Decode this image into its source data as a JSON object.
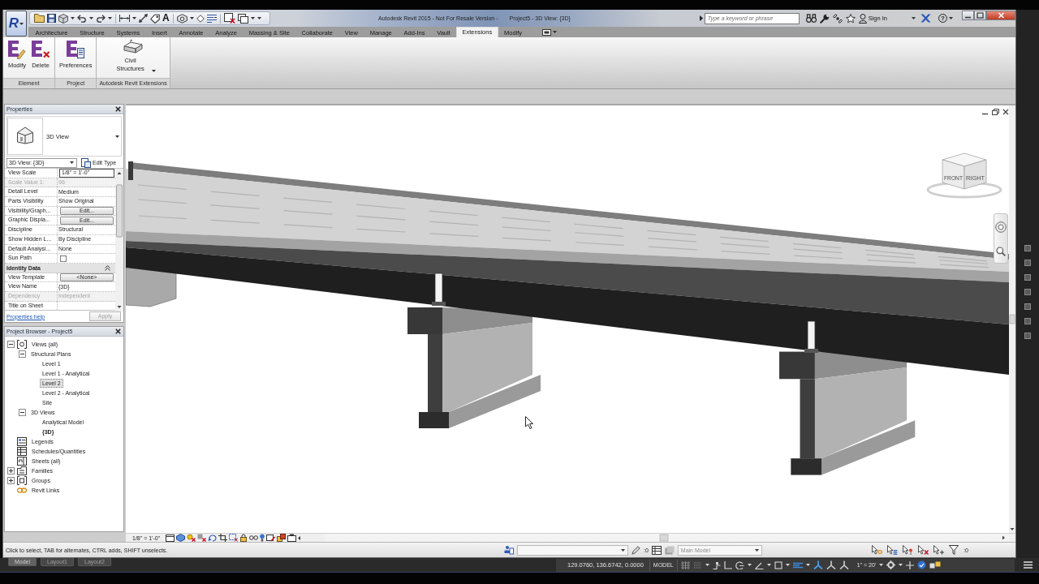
{
  "title_bar": {
    "app_button": "R",
    "text_tool": "A",
    "title": "Autodesk Revit 2015 - Not For Resale Version -",
    "document": "Project5 - 3D View: {3D}",
    "search": {
      "placeholder": "Type a keyword or phrase"
    },
    "sign_in": "Sign In",
    "help": "?"
  },
  "ribbon": {
    "tabs": [
      {
        "label": "Architecture",
        "selected": false
      },
      {
        "label": "Structure",
        "selected": false
      },
      {
        "label": "Systems",
        "selected": false
      },
      {
        "label": "Insert",
        "selected": false
      },
      {
        "label": "Annotate",
        "selected": false
      },
      {
        "label": "Analyze",
        "selected": false
      },
      {
        "label": "Massing & Site",
        "selected": false
      },
      {
        "label": "Collaborate",
        "selected": false
      },
      {
        "label": "View",
        "selected": false
      },
      {
        "label": "Manage",
        "selected": false
      },
      {
        "label": "Add-Ins",
        "selected": false
      },
      {
        "label": "Vault",
        "selected": false
      },
      {
        "label": "Extensions",
        "selected": true
      },
      {
        "label": "Modify",
        "selected": false
      }
    ],
    "panels": [
      {
        "label": "Element",
        "buttons": [
          {
            "label": "Modify",
            "kind": "modify",
            "dropdown": false
          },
          {
            "label": "Delete",
            "kind": "delete",
            "dropdown": false
          }
        ]
      },
      {
        "label": "Project",
        "buttons": [
          {
            "label": "Preferences",
            "kind": "preferences",
            "dropdown": false
          }
        ]
      },
      {
        "label": "Autodesk Revit Extensions",
        "buttons": [
          {
            "label": "Civil Structures",
            "kind": "civil",
            "dropdown": true
          }
        ]
      }
    ]
  },
  "properties": {
    "title": "Properties",
    "type_name": "3D View",
    "instance_selector": "3D View: {3D}",
    "edit_type": "Edit Type",
    "rows": [
      {
        "kind": "input",
        "name": "View Scale",
        "value": "1/8\" = 1'-0\"",
        "disabled": false
      },
      {
        "kind": "text",
        "name": "Scale Value    1:",
        "value": "96",
        "disabled": true
      },
      {
        "kind": "text",
        "name": "Detail Level",
        "value": "Medium",
        "disabled": false
      },
      {
        "kind": "text",
        "name": "Parts Visibility",
        "value": "Show Original",
        "disabled": false
      },
      {
        "kind": "button",
        "name": "Visibility/Graph...",
        "value": "Edit...",
        "disabled": false
      },
      {
        "kind": "button",
        "name": "Graphic Displa...",
        "value": "Edit...",
        "disabled": false
      },
      {
        "kind": "text",
        "name": "Discipline",
        "value": "Structural",
        "disabled": false
      },
      {
        "kind": "text",
        "name": "Show Hidden L...",
        "value": "By Discipline",
        "disabled": false
      },
      {
        "kind": "text",
        "name": "Default Analysi...",
        "value": "None",
        "disabled": false
      },
      {
        "kind": "checkbox",
        "name": "Sun Path",
        "checked": false,
        "disabled": false
      },
      {
        "kind": "section",
        "name": "Identity Data",
        "expanded": true
      },
      {
        "kind": "button",
        "name": "View Template",
        "value": "<None>",
        "disabled": false
      },
      {
        "kind": "text",
        "name": "View Name",
        "value": "{3D}",
        "disabled": false
      },
      {
        "kind": "text",
        "name": "Dependency",
        "value": "Independent",
        "disabled": true
      },
      {
        "kind": "text",
        "name": "Title on Sheet",
        "disabled": false
      }
    ],
    "help_link": "Properties help",
    "apply": {
      "label": "Apply",
      "disabled": true
    }
  },
  "project_browser": {
    "title": "Project Browser - Project5",
    "tree": [
      {
        "label": "Views (all)",
        "kind": "views",
        "expanded": true,
        "selected": false,
        "active": false,
        "children": [
          {
            "label": "Structural Plans",
            "expanded": true,
            "selected": false,
            "active": false,
            "children": [
              {
                "label": "Level 1",
                "selected": false,
                "active": false
              },
              {
                "label": "Level 1 - Analytical",
                "selected": false,
                "active": false
              },
              {
                "label": "Level 2",
                "selected": true,
                "active": false
              },
              {
                "label": "Level 2 - Analytical",
                "selected": false,
                "active": false
              },
              {
                "label": "Site",
                "selected": false,
                "active": false
              }
            ]
          },
          {
            "label": "3D Views",
            "expanded": true,
            "selected": false,
            "active": false,
            "children": [
              {
                "label": "Analytical Model",
                "selected": false,
                "active": false
              },
              {
                "label": "{3D}",
                "selected": false,
                "active": true
              }
            ]
          }
        ]
      },
      {
        "label": "Legends",
        "kind": "legends",
        "selected": false,
        "active": false
      },
      {
        "label": "Schedules/Quantities",
        "kind": "schedules",
        "selected": false,
        "active": false
      },
      {
        "label": "Sheets (all)",
        "kind": "sheets",
        "selected": false,
        "active": false
      },
      {
        "label": "Families",
        "kind": "families",
        "expanded": false,
        "selected": false,
        "active": false
      },
      {
        "label": "Groups",
        "kind": "groups",
        "expanded": false,
        "selected": false,
        "active": false
      },
      {
        "label": "Revit Links",
        "kind": "links",
        "selected": false,
        "active": false
      }
    ]
  },
  "view": {
    "viewcube": {
      "front": "FRONT",
      "right": "RIGHT"
    },
    "scale": "1/8\" = 1'-0\""
  },
  "status_bar": {
    "message": "Click to select, TAB for alternates, CTRL adds, SHIFT unselects.",
    "editable_count": ":0",
    "design_option": {
      "value": "Main Model",
      "disabled": true
    },
    "selection_count": ":0"
  },
  "background_window": {
    "tabs": [
      {
        "label": "Model",
        "selected": true
      },
      {
        "label": "Layout1",
        "selected": false
      },
      {
        "label": "Layout2",
        "selected": false
      }
    ],
    "coordinates": "129.0760, 136.6742, 0.0000",
    "space": "MODEL",
    "annotation_scale": "1\" = 20'"
  }
}
